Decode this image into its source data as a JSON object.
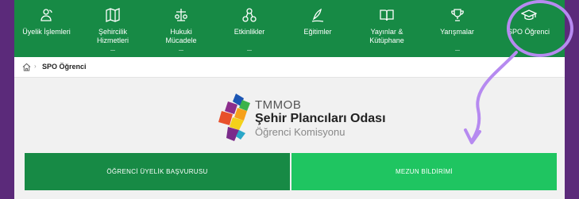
{
  "nav": {
    "items": [
      {
        "label": "Üyelik İşlemleri",
        "icon": "users-icon"
      },
      {
        "label": "Şehircilik Hizmetleri",
        "icon": "map-icon"
      },
      {
        "label": "Hukuki Mücadele",
        "icon": "scale-icon"
      },
      {
        "label": "Etkinlikler",
        "icon": "network-icon"
      },
      {
        "label": "Eğitimler",
        "icon": "pen-icon"
      },
      {
        "label": "Yayınlar & Kütüphane",
        "icon": "book-icon"
      },
      {
        "label": "Yarışmalar",
        "icon": "trophy-icon"
      },
      {
        "label": "SPO Öğrenci",
        "icon": "graduation-cap-icon"
      }
    ]
  },
  "breadcrumb": {
    "separator": "›",
    "current": "SPO Öğrenci"
  },
  "logo": {
    "line1": "TMMOB",
    "line2": "Şehir Plancıları Odası",
    "line3": "Öğrenci Komisyonu"
  },
  "buttons": {
    "left": "ÖĞRENCİ ÜYELİK BAŞVURUSU",
    "right": "MEZUN BİLDİRİMİ"
  },
  "colors": {
    "nav_bg": "#178a45",
    "button_dark": "#178a45",
    "button_light": "#1fc561",
    "annotation": "#b68af0",
    "frame": "#5b2a7a"
  }
}
